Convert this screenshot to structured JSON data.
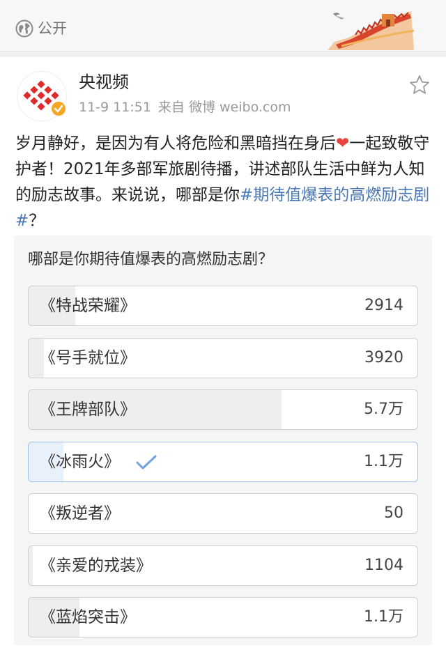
{
  "topbar": {
    "visibility_label": "公开",
    "globe_icon": "globe-icon",
    "banner_icon": "great-wall-banner"
  },
  "post": {
    "author": "央视频",
    "date": "11-9 11:51",
    "source": "来自 微博 weibo.com",
    "text_part1": "岁月静好，是因为有人将危险和黑暗挡在身后",
    "text_part2": "一起致敬守护者！2021年多部军旅剧待播，讲述部队生活中鲜为人知的励志故事。来说说，哪部是你",
    "hashtag": "#期待值爆表的高燃励志剧#",
    "text_part3": "？",
    "heart": "❤",
    "verified_badge_color": "#f6a623",
    "link_color": "#4a78b5"
  },
  "poll": {
    "question": "哪部是你期待值爆表的高燃励志剧？",
    "options": [
      {
        "label": "《特战荣耀》",
        "count": "2914",
        "share": 0.12,
        "selected": false
      },
      {
        "label": "《号手就位》",
        "count": "3920",
        "share": 0.04,
        "selected": false
      },
      {
        "label": "《王牌部队》",
        "count": "5.7万",
        "share": 0.65,
        "selected": false
      },
      {
        "label": "《冰雨火》",
        "count": "1.1万",
        "share": 0.09,
        "selected": true
      },
      {
        "label": "《叛逆者》",
        "count": "50",
        "share": 0.0,
        "selected": false
      },
      {
        "label": "《亲爱的戎装》",
        "count": "1104",
        "share": 0.01,
        "selected": false
      },
      {
        "label": "《蓝焰突击》",
        "count": "1.1万",
        "share": 0.13,
        "selected": false
      }
    ]
  }
}
